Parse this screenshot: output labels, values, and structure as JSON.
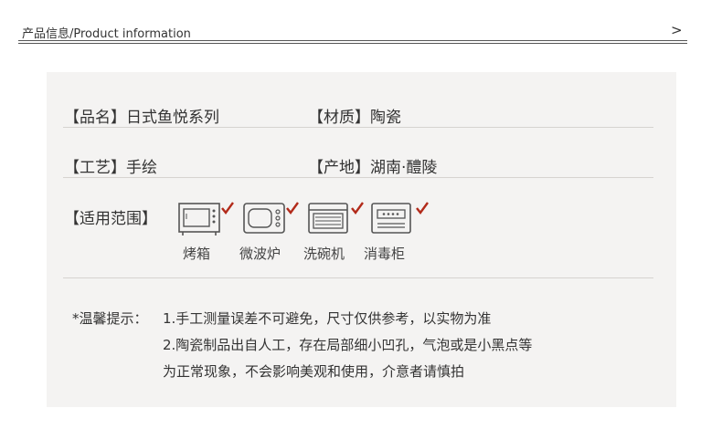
{
  "header": {
    "title": "产品信息/Product information",
    "arrow": ">"
  },
  "info": {
    "name": "【品名】日式鱼悦系列",
    "material": "【材质】陶瓷",
    "craft": "【工艺】手绘",
    "origin": "【产地】湖南·醴陵",
    "usage_label": "【适用范围】"
  },
  "appliances": [
    {
      "label": "烤箱",
      "icon": "oven-icon",
      "checked": true
    },
    {
      "label": "微波炉",
      "icon": "microwave-icon",
      "checked": true
    },
    {
      "label": "洗碗机",
      "icon": "dishwasher-icon",
      "checked": true
    },
    {
      "label": "消毒柜",
      "icon": "sterilizer-cabinet-icon",
      "checked": true
    }
  ],
  "notice": {
    "prefix": "*温馨提示：",
    "line1": "1.手工测量误差不可避免，尺寸仅供参考，以实物为准",
    "line2": "2.陶瓷制品出自人工，存在局部细小凹孔，气泡或是小黑点等",
    "line3": "为正常现象，不会影响美观和使用，介意者请慎拍"
  },
  "colors": {
    "check": "#b22a1a",
    "panel": "#f4f3f2",
    "rule": "#d6d3d0",
    "icon": "#555555"
  }
}
